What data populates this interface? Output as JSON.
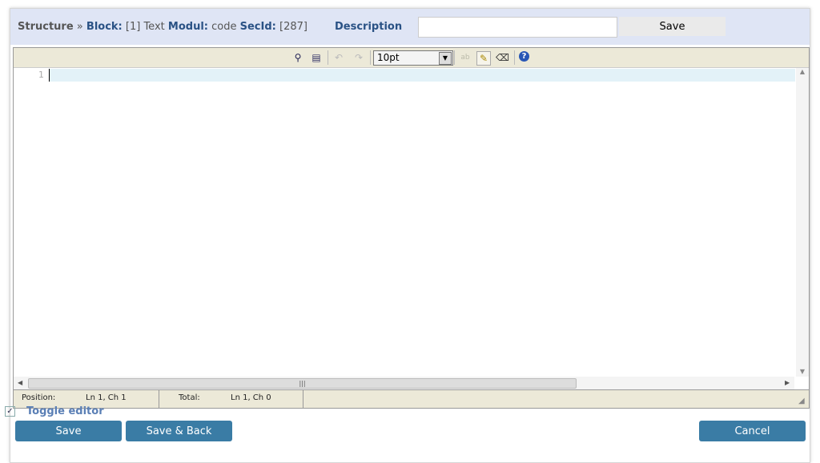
{
  "header": {
    "structure": "Structure",
    "sep": "»",
    "block_label": "Block:",
    "block_value": "[1] Text",
    "modul_label": "Modul:",
    "modul_value": "code",
    "secid_label": "SecId:",
    "secid_value": "[287]",
    "description_label": "Description",
    "description_value": "",
    "save_label": "Save"
  },
  "toolbar": {
    "icons": [
      "search-icon",
      "fullscreen-icon",
      "undo-icon",
      "redo-icon",
      "spellcheck-icon",
      "highlight-icon",
      "eraser-icon",
      "help-icon"
    ],
    "font_size": "10pt"
  },
  "editor": {
    "line_numbers": [
      "1"
    ]
  },
  "status": {
    "position_label": "Position:",
    "position_value": "Ln 1, Ch 1",
    "total_label": "Total:",
    "total_value": "Ln 1, Ch 0"
  },
  "footer": {
    "toggle_label": "Toggle editor",
    "toggle_checked": true,
    "save": "Save",
    "save_back": "Save & Back",
    "cancel": "Cancel"
  }
}
